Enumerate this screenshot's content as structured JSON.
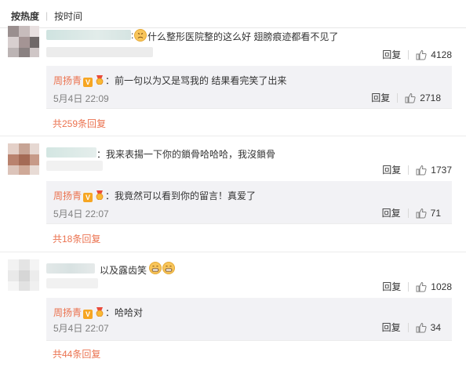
{
  "tabs": [
    "按热度",
    "按时间"
  ],
  "reply_label": "回复",
  "comments": [
    {
      "text": "什么整形医院整的这么好 翅膀痕迹都看不见了",
      "likes": "4128",
      "reply": {
        "user": "周扬青",
        "badge": "V",
        "text": "：前一句以为又是骂我的 结果看完笑了出来",
        "time": "5月4日 22:09",
        "likes": "2718"
      },
      "more": "共259条回复"
    },
    {
      "text": "：我来表揚一下你的鎖骨哈哈哈，我沒鎖骨",
      "likes": "1737",
      "reply": {
        "user": "周扬青",
        "badge": "V",
        "text": "：我竟然可以看到你的留言！真爱了",
        "time": "5月4日 22:07",
        "likes": "71"
      },
      "more": "共18条回复"
    },
    {
      "text": "以及露齿笑",
      "likes": "1028",
      "reply": {
        "user": "周扬青",
        "badge": "V",
        "text": "：哈哈对",
        "time": "5月4日 22:07",
        "likes": "34"
      },
      "more": "共44条回复"
    }
  ],
  "colors": {
    "accent": "#eb7350",
    "reply_bg": "#f2f2f5",
    "badge": "#f6a623"
  },
  "icons": {
    "like": "thumbs-up-icon",
    "emoji": "grin-emoji-icon",
    "medal": "medal-icon"
  }
}
